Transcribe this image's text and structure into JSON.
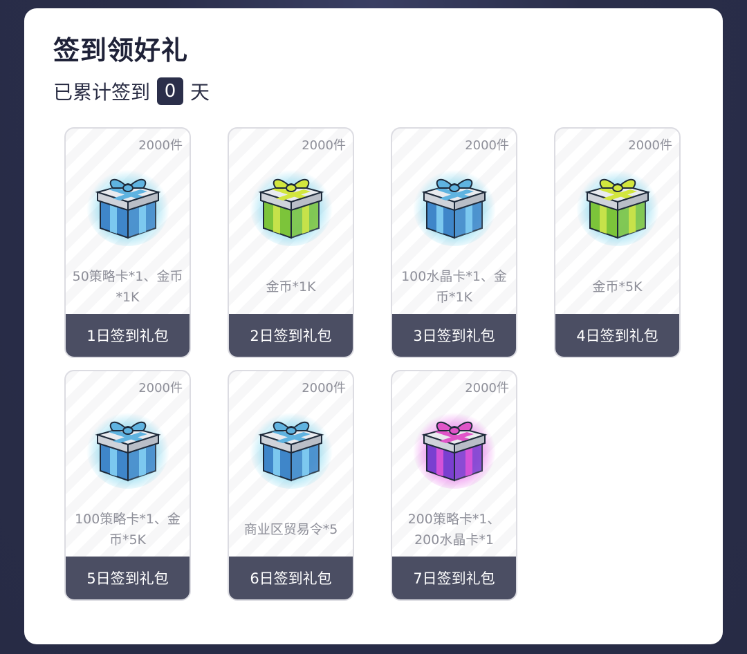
{
  "header": {
    "title": "签到领好礼",
    "progress_prefix": "已累计签到",
    "days": "0",
    "progress_suffix": "天"
  },
  "cards": [
    {
      "qty": "2000件",
      "desc": "50策略卡*1、金币*1K",
      "label": "1日签到礼包",
      "gift_color": "blue"
    },
    {
      "qty": "2000件",
      "desc": "金币*1K",
      "label": "2日签到礼包",
      "gift_color": "green"
    },
    {
      "qty": "2000件",
      "desc": "100水晶卡*1、金币*1K",
      "label": "3日签到礼包",
      "gift_color": "blue"
    },
    {
      "qty": "2000件",
      "desc": "金币*5K",
      "label": "4日签到礼包",
      "gift_color": "green"
    },
    {
      "qty": "2000件",
      "desc": "100策略卡*1、金币*5K",
      "label": "5日签到礼包",
      "gift_color": "blue"
    },
    {
      "qty": "2000件",
      "desc": "商业区贸易令*5",
      "label": "6日签到礼包",
      "gift_color": "blue"
    },
    {
      "qty": "2000件",
      "desc": "200策略卡*1、200水晶卡*1",
      "label": "7日签到礼包",
      "gift_color": "purple"
    }
  ],
  "gift_palette": {
    "blue": {
      "body": "#3f86c9",
      "stripe": "#7cc8ef",
      "ribbon": "#5fb3e0",
      "glow": "#7fd6ef"
    },
    "green": {
      "body": "#7cc43a",
      "stripe": "#c6e24a",
      "ribbon": "#d2e63e",
      "glow": "#7fd6ef"
    },
    "purple": {
      "body": "#7a3fd0",
      "stripe": "#d452d8",
      "ribbon": "#e055c8",
      "glow": "#e873ea"
    }
  }
}
